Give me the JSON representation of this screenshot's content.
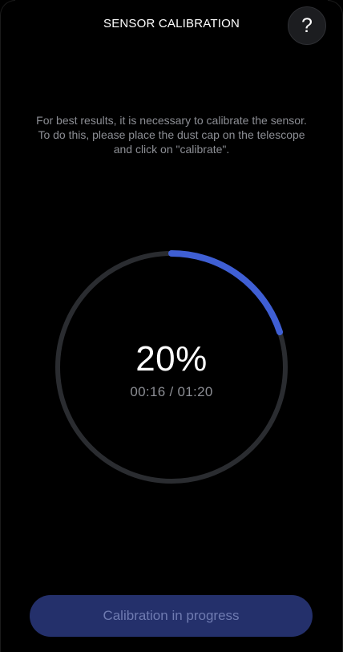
{
  "header": {
    "title": "SENSOR CALIBRATION",
    "help_label": "?"
  },
  "instructions": {
    "line1": "For best results, it is necessary to calibrate the sensor.",
    "line2": "To do this, please place the dust cap on the telescope",
    "line3": "and click on \"calibrate\"."
  },
  "progress": {
    "percent_label": "20%",
    "fraction": 0.2,
    "elapsed": "00:16 / 01:20",
    "track_color": "#2a2c30",
    "fill_color": "#3f5fd4"
  },
  "action": {
    "label": "Calibration in progress",
    "background_color": "#24306b",
    "text_color": "#6f7bb1"
  }
}
